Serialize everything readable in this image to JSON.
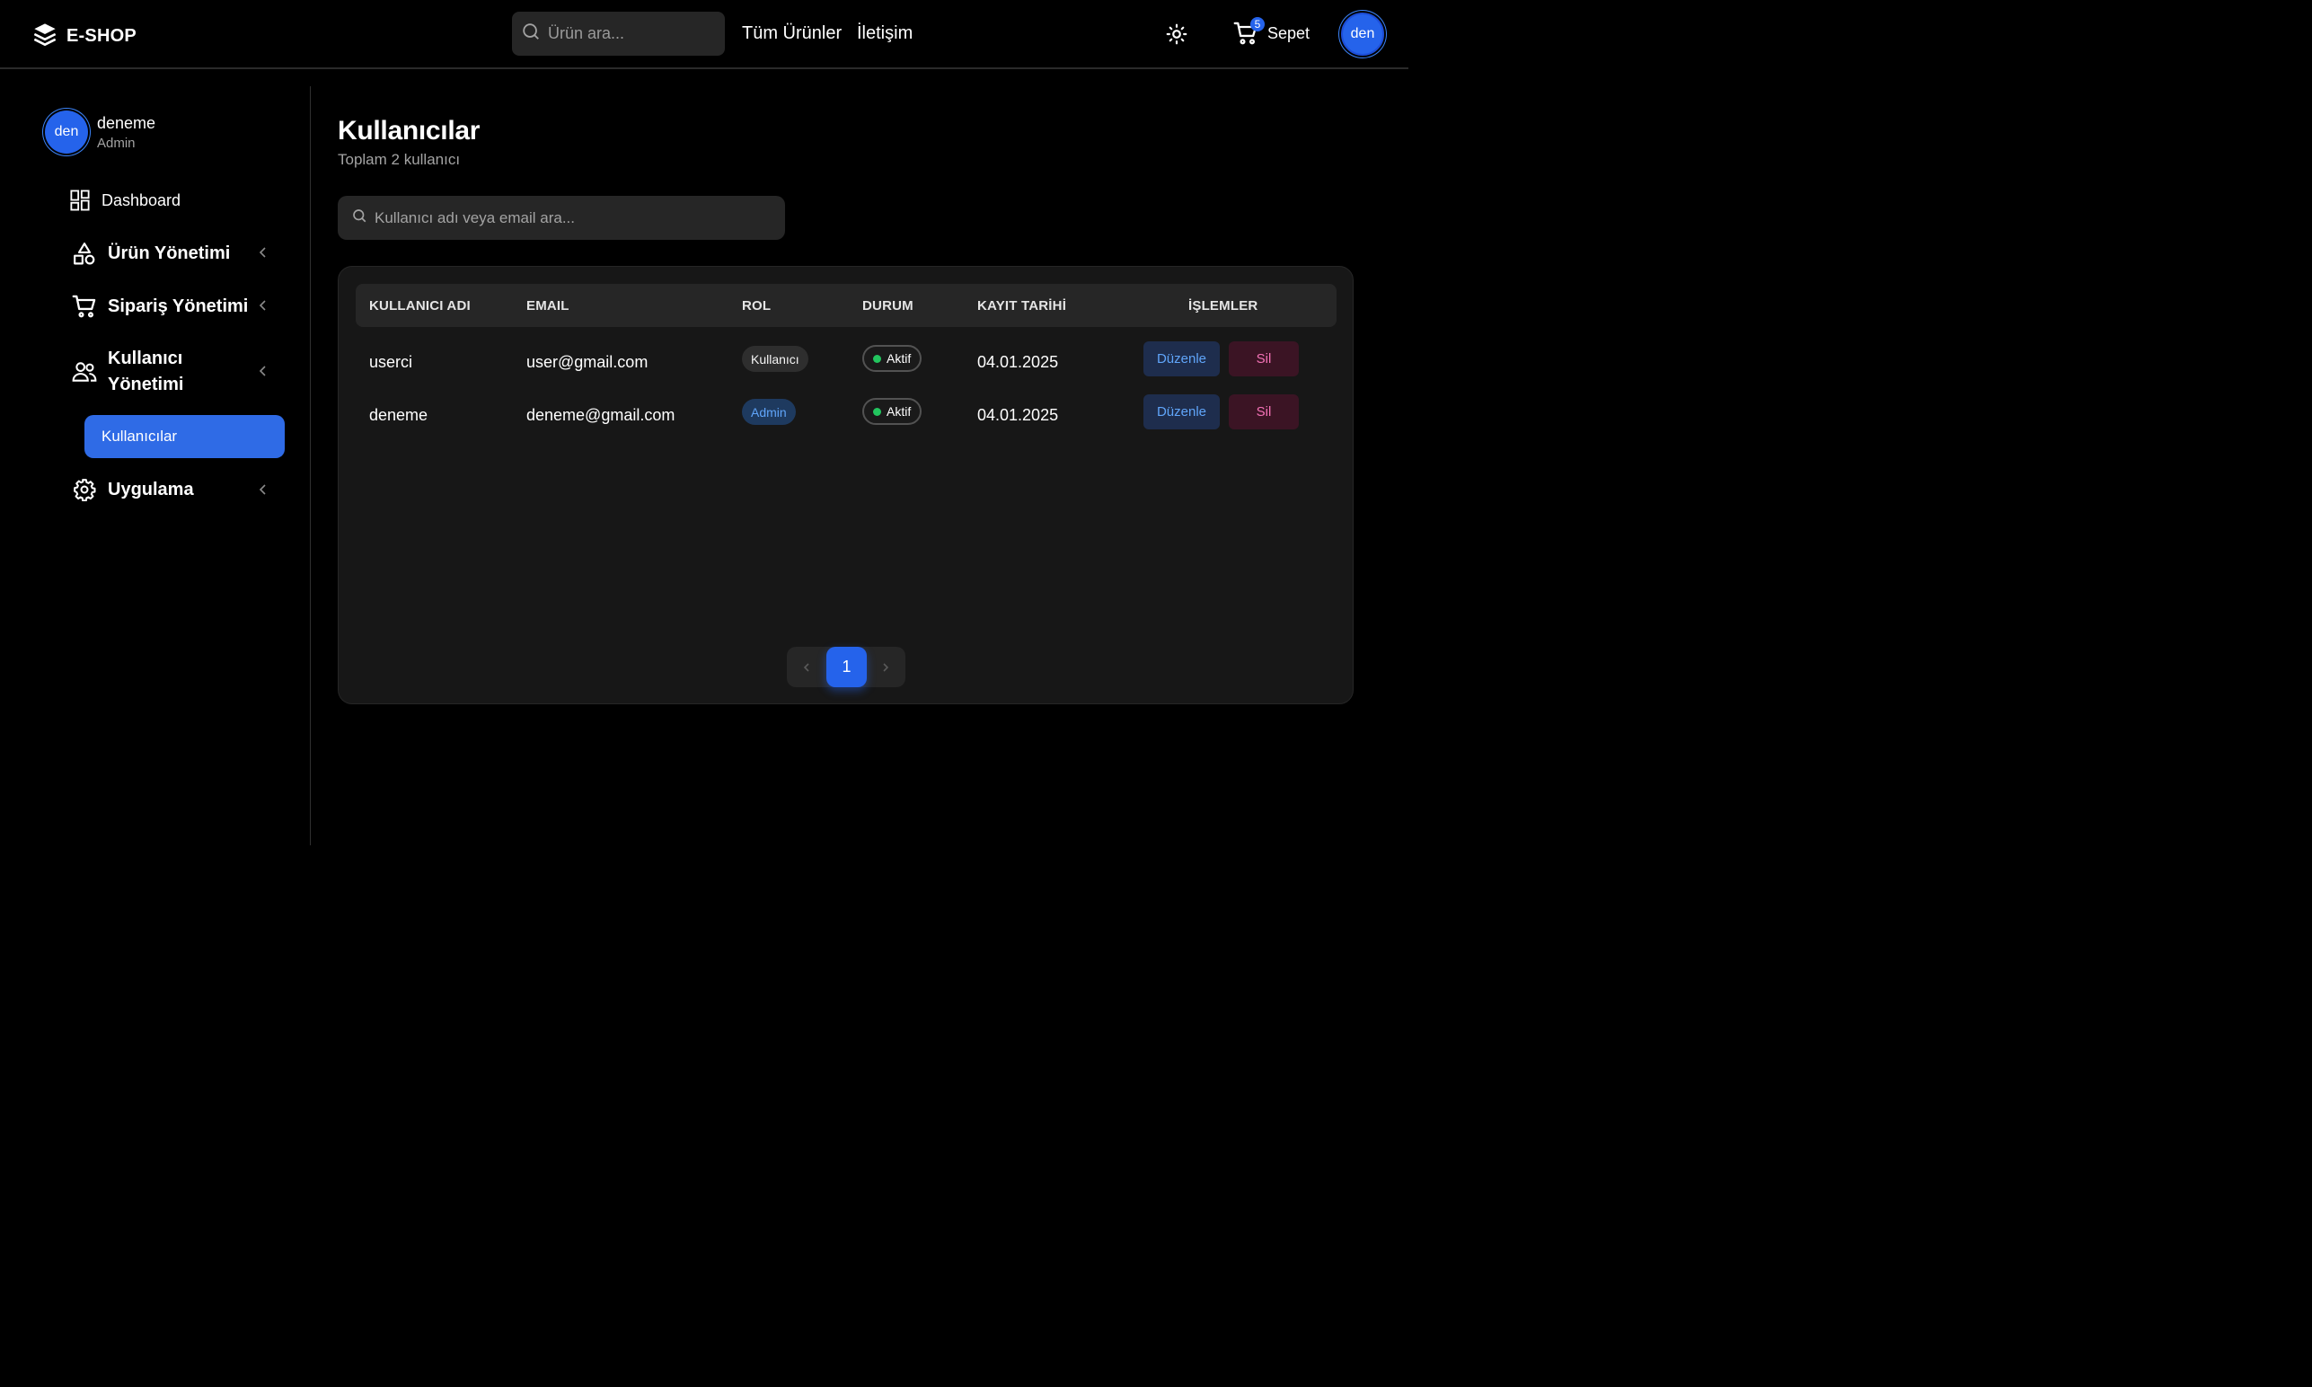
{
  "colors": {
    "accent": "#2563eb",
    "background": "#000000",
    "card": "#171717",
    "status_active": "#22c55e",
    "delete": "#f472b6"
  },
  "navbar": {
    "brand": "E-SHOP",
    "brand_icon": "layers-icon",
    "search_placeholder": "Ürün ara...",
    "links": [
      "Tüm Ürünler",
      "İletişim"
    ],
    "theme_icon": "sun-icon",
    "cart_count": "5",
    "cart_label": "Sepet",
    "avatar_initials": "den"
  },
  "sidebar": {
    "profile": {
      "initials": "den",
      "name": "deneme",
      "role": "Admin"
    },
    "items": [
      {
        "label": "Dashboard",
        "icon": "dashboard-icon"
      },
      {
        "label": "Ürün Yönetimi",
        "icon": "shapes-icon"
      },
      {
        "label": "Sipariş Yönetimi",
        "icon": "cart-icon"
      },
      {
        "label_line1": "Kullanıcı",
        "label_line2": "Yönetimi",
        "icon": "users-icon"
      },
      {
        "label": "Uygulama",
        "icon": "gear-icon"
      }
    ],
    "active_submenu": "Kullanıcılar"
  },
  "main": {
    "title": "Kullanıcılar",
    "subtitle": "Toplam 2 kullanıcı",
    "search_placeholder": "Kullanıcı adı veya email ara...",
    "table": {
      "headers": [
        "KULLANICI ADI",
        "EMAIL",
        "ROL",
        "DURUM",
        "KAYIT TARİHİ",
        "İŞLEMLER"
      ],
      "rows": [
        {
          "username": "userci",
          "email": "user@gmail.com",
          "role": "Kullanıcı",
          "status": "Aktif",
          "date": "04.01.2025",
          "edit": "Düzenle",
          "delete": "Sil"
        },
        {
          "username": "deneme",
          "email": "deneme@gmail.com",
          "role": "Admin",
          "status": "Aktif",
          "date": "04.01.2025",
          "edit": "Düzenle",
          "delete": "Sil"
        }
      ]
    },
    "pagination": {
      "current": "1"
    }
  }
}
